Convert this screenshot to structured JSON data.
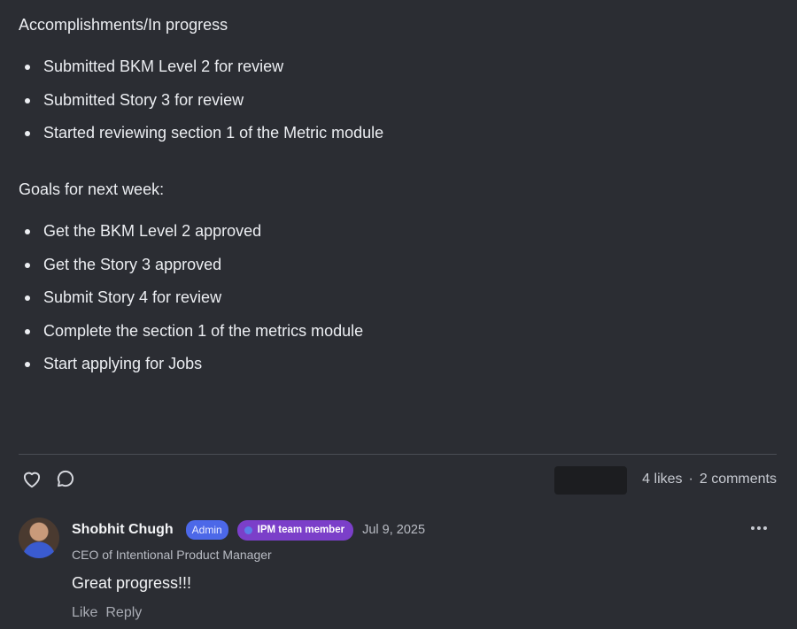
{
  "post": {
    "accomplishments": {
      "heading": "Accomplishments/In progress",
      "items": [
        "Submitted BKM Level 2 for review",
        "Submitted Story 3 for review",
        "Started reviewing section 1 of the Metric module"
      ]
    },
    "goals": {
      "heading": "Goals for next week:",
      "items": [
        "Get the BKM Level 2 approved",
        "Get the Story 3 approved",
        "Submit Story 4 for review",
        "Complete the section 1 of the metrics module",
        "Start applying for Jobs"
      ]
    }
  },
  "actions": {
    "like_icon": "heart-icon",
    "comment_icon": "comment-bubble-icon",
    "likes": "4 likes",
    "separator": "·",
    "comments": "2 comments"
  },
  "comment": {
    "author": "Shobhit Chugh",
    "admin_badge": "Admin",
    "team_badge": "IPM team member",
    "date": "Jul 9, 2025",
    "role": "CEO of Intentional Product Manager",
    "text": "Great progress!!!",
    "like_label": "Like",
    "reply_label": "Reply",
    "menu_icon": "more-horizontal-icon"
  },
  "colors": {
    "background": "#2b2d33",
    "admin_badge": "#4c68e8",
    "team_badge": "#7b3fc9"
  }
}
